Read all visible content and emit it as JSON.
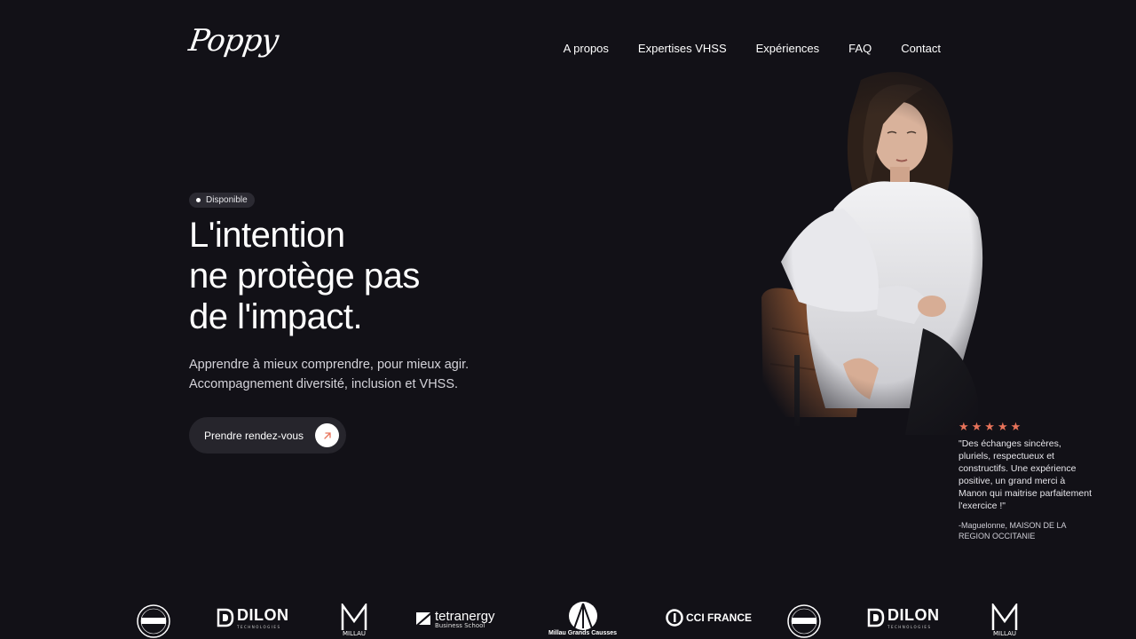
{
  "brand": {
    "logo_text": "Poppy"
  },
  "nav": {
    "items": [
      "A propos",
      "Expertises VHSS",
      "Expériences",
      "FAQ",
      "Contact"
    ]
  },
  "hero": {
    "badge": "Disponible",
    "headline": [
      "L'intention",
      "ne protège pas",
      "de l'impact."
    ],
    "subtitle": [
      "Apprendre à mieux comprendre, pour mieux agir.",
      "Accompagnement diversité, inclusion et VHSS."
    ],
    "cta_label": "Prendre rendez-vous"
  },
  "review": {
    "stars": 5,
    "stars_text": "★★★★★",
    "quote": "\"Des échanges sincères, pluriels, respectueux et constructifs. Une expérience positive, un grand merci à Manon qui maitrise parfaitement l'exercice !\"",
    "author": "-Maguelonne, MAISON DE LA REGION OCCITANIE"
  },
  "partners": {
    "dilon": "DILON",
    "dilon_sub": "TECHNOLOGIES",
    "millau": "MILLAU",
    "tetra_main": "tetranergy",
    "tetra_sub": "Business School",
    "millau_gc": "Millau Grands Causses",
    "cci": "CCI FRANCE",
    "familiale": "FAMILIALE"
  },
  "colors": {
    "background": "#121117",
    "accent": "#e8735a",
    "button_bg": "#26252c"
  }
}
